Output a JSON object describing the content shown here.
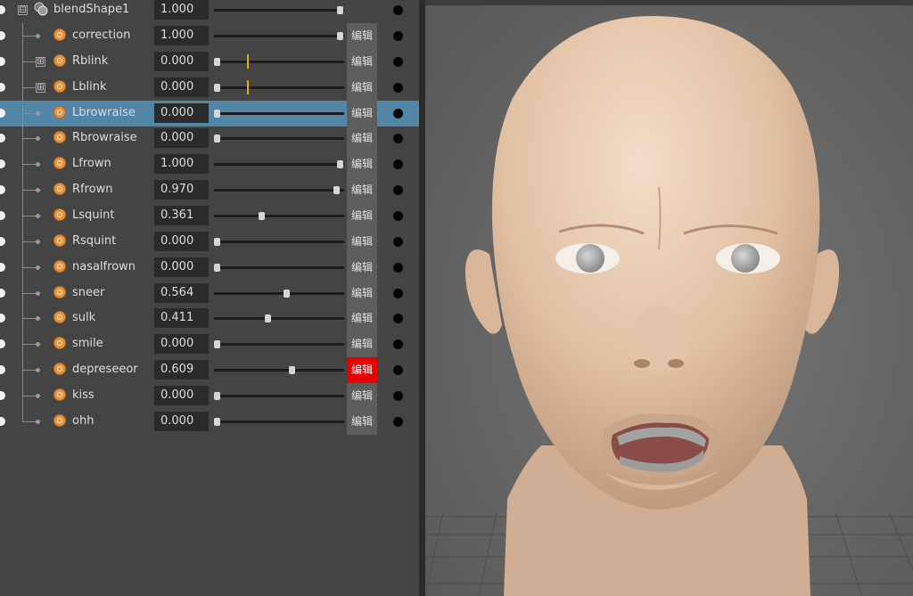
{
  "blend_shape": {
    "name": "blendShape1",
    "weight": "1.000",
    "weight_fraction": 1.0,
    "expand_symbol": "⊟"
  },
  "edit_label": "编辑",
  "expand_plus": "⊞",
  "targets": [
    {
      "name": "correction",
      "value": "1.000",
      "fraction": 1.0,
      "expandable": false,
      "selected": false,
      "edit_active": false
    },
    {
      "name": "Rblink",
      "value": "0.000",
      "fraction": 0.0,
      "expandable": true,
      "selected": false,
      "edit_active": false,
      "key_tick": 0.25
    },
    {
      "name": "Lblink",
      "value": "0.000",
      "fraction": 0.0,
      "expandable": true,
      "selected": false,
      "edit_active": false,
      "key_tick": 0.25
    },
    {
      "name": "Lbrowraise",
      "value": "0.000",
      "fraction": 0.0,
      "expandable": false,
      "selected": true,
      "edit_active": false
    },
    {
      "name": "Rbrowraise",
      "value": "0.000",
      "fraction": 0.0,
      "expandable": false,
      "selected": false,
      "edit_active": false
    },
    {
      "name": "Lfrown",
      "value": "1.000",
      "fraction": 1.0,
      "expandable": false,
      "selected": false,
      "edit_active": false
    },
    {
      "name": "Rfrown",
      "value": "0.970",
      "fraction": 0.97,
      "expandable": false,
      "selected": false,
      "edit_active": false
    },
    {
      "name": "Lsquint",
      "value": "0.361",
      "fraction": 0.361,
      "expandable": false,
      "selected": false,
      "edit_active": false
    },
    {
      "name": "Rsquint",
      "value": "0.000",
      "fraction": 0.0,
      "expandable": false,
      "selected": false,
      "edit_active": false
    },
    {
      "name": "nasalfrown",
      "value": "0.000",
      "fraction": 0.0,
      "expandable": false,
      "selected": false,
      "edit_active": false
    },
    {
      "name": "sneer",
      "value": "0.564",
      "fraction": 0.564,
      "expandable": false,
      "selected": false,
      "edit_active": false
    },
    {
      "name": "sulk",
      "value": "0.411",
      "fraction": 0.411,
      "expandable": false,
      "selected": false,
      "edit_active": false
    },
    {
      "name": "smile",
      "value": "0.000",
      "fraction": 0.0,
      "expandable": false,
      "selected": false,
      "edit_active": false
    },
    {
      "name": "depreseeor",
      "value": "0.609",
      "fraction": 0.609,
      "expandable": false,
      "selected": false,
      "edit_active": true
    },
    {
      "name": "kiss",
      "value": "0.000",
      "fraction": 0.0,
      "expandable": false,
      "selected": false,
      "edit_active": false
    },
    {
      "name": "ohh",
      "value": "0.000",
      "fraction": 0.0,
      "expandable": false,
      "selected": false,
      "edit_active": false
    }
  ],
  "colors": {
    "panel_bg": "#444444",
    "selected_row": "#5285a6",
    "edit_active": "#e60000",
    "shape_icon": "#e8923a",
    "skin": "#e6c4aa",
    "viewport_bg": "#6a6a6a"
  },
  "viewport": {
    "content": "3D head model"
  }
}
